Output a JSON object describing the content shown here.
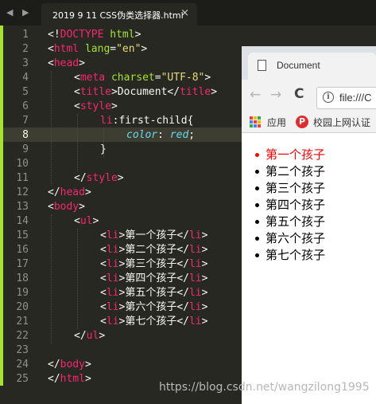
{
  "editor": {
    "tab_title": "2019 9 11 CSS伪类选择器.html",
    "close_glyph": "×",
    "nav_glyph": "◀ ▶",
    "line_numbers": [
      "1",
      "2",
      "3",
      "4",
      "5",
      "6",
      "7",
      "8",
      "9",
      "10",
      "11",
      "12",
      "13",
      "14",
      "15",
      "16",
      "17",
      "18",
      "19",
      "20",
      "21",
      "22",
      "23",
      "24",
      "25"
    ],
    "active_line": "8",
    "code": {
      "l1_a": "<!",
      "l1_b": "DOCTYPE",
      "l1_c": " html",
      "l1_d": ">",
      "l2_a": "<",
      "l2_b": "html",
      "l2_c": " lang",
      "l2_d": "=",
      "l2_e": "\"en\"",
      "l2_f": ">",
      "l3_a": "<",
      "l3_b": "head",
      "l3_c": ">",
      "l4_a": "<",
      "l4_b": "meta",
      "l4_c": " charset",
      "l4_d": "=",
      "l4_e": "\"UTF-8\"",
      "l4_f": ">",
      "l5_a": "<",
      "l5_b": "title",
      "l5_c": ">Document</",
      "l5_d": "title",
      "l5_e": ">",
      "l6_a": "<",
      "l6_b": "style",
      "l6_c": ">",
      "l7_a": "li",
      "l7_b": ":first-child{",
      "l8_a": "color",
      "l8_b": ": ",
      "l8_c": "red",
      "l8_d": ";",
      "l9": "}",
      "l11_a": "</",
      "l11_b": "style",
      "l11_c": ">",
      "l12_a": "</",
      "l12_b": "head",
      "l12_c": ">",
      "l13_a": "<",
      "l13_b": "body",
      "l13_c": ">",
      "l14_a": "<",
      "l14_b": "ul",
      "l14_c": ">",
      "li_open": "<",
      "li_tag": "li",
      "li_mid": ">",
      "li_close_open": "</",
      "li_close_end": ">",
      "items": [
        "第一个孩子",
        "第二个孩子",
        "第三个孩子",
        "第四个孩子",
        "第五个孩子",
        "第六个孩子",
        "第七个孩子"
      ],
      "l22_a": "</",
      "l22_b": "ul",
      "l22_c": ">",
      "l24_a": "</",
      "l24_b": "body",
      "l24_c": ">",
      "l25_a": "</",
      "l25_b": "html",
      "l25_c": ">"
    }
  },
  "browser": {
    "tab_title": "Document",
    "url": "file:///C",
    "back_glyph": "←",
    "forward_glyph": "→",
    "reload_glyph": "C",
    "info_glyph": "i",
    "bookmarks": [
      "应用",
      "校园上网认证"
    ],
    "bookmark_badge": "P",
    "list_items": [
      "第一个孩子",
      "第二个孩子",
      "第三个孩子",
      "第四个孩子",
      "第五个孩子",
      "第六个孩子",
      "第七个孩子"
    ],
    "colors": {
      "first_item": "#ff0000",
      "apps": [
        "#ea4335",
        "#fbbc05",
        "#34a853",
        "#4285f4",
        "#ea4335",
        "#fbbc05",
        "#34a853",
        "#4285f4",
        "#ea4335"
      ]
    }
  },
  "watermark": "https://blog.csdn.net/wangzilong1995"
}
